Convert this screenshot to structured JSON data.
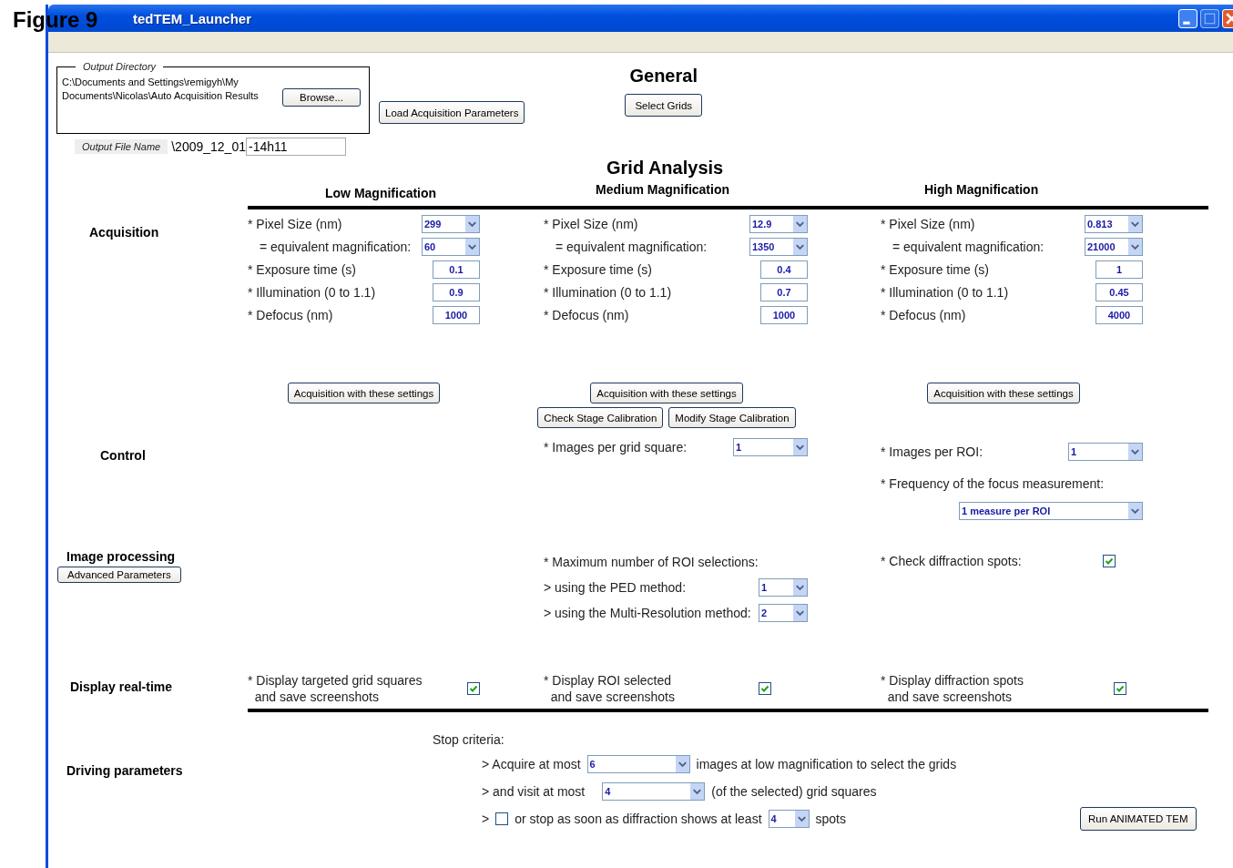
{
  "figure_label": "Figure 9",
  "window": {
    "title": "tedTEM_Launcher"
  },
  "output_directory": {
    "legend": "Output Directory",
    "path": "C:\\Documents and Settings\\remigyh\\My Documents\\Nicolas\\Auto Acquisition Results",
    "browse_button": "Browse..."
  },
  "load_button": "Load Acquisition Parameters",
  "general": {
    "heading": "General",
    "button": "Select Grids"
  },
  "output_file_name": {
    "label": "Output File Name",
    "prefix": "\\2009_12_01",
    "value": "-14h11"
  },
  "grid_analysis": {
    "heading": "Grid Analysis",
    "columns": [
      "Low Magnification",
      "Medium Magnification",
      "High Magnification"
    ]
  },
  "sections": [
    {
      "label": "Acquisition",
      "columns": [
        {
          "items": [
            {
              "kind": "select",
              "label": "* Pixel Size (nm)",
              "value": "299"
            },
            {
              "kind": "derived_select",
              "label": "= equivalent magnification:",
              "value": "60"
            },
            {
              "kind": "input",
              "label": "* Exposure time (s)",
              "value": "0.1"
            },
            {
              "kind": "input",
              "label": "* Illumination (0 to 1.1)",
              "value": "0.9"
            },
            {
              "kind": "input",
              "label": "* Defocus (nm)",
              "value": "1000"
            }
          ],
          "buttons": [
            "Acquisition with these settings"
          ]
        },
        {
          "items": [
            {
              "kind": "select",
              "label": "* Pixel Size (nm)",
              "value": "12.9"
            },
            {
              "kind": "derived_select",
              "label": "= equivalent magnification:",
              "value": "1350"
            },
            {
              "kind": "input",
              "label": "* Exposure time (s)",
              "value": "0.4"
            },
            {
              "kind": "input",
              "label": "* Illumination (0 to 1.1)",
              "value": "0.7"
            },
            {
              "kind": "input",
              "label": "* Defocus (nm)",
              "value": "1000"
            }
          ],
          "buttons": [
            "Acquisition with these settings"
          ],
          "extra_buttons": [
            "Check Stage Calibration",
            "Modify Stage Calibration"
          ]
        },
        {
          "items": [
            {
              "kind": "select",
              "label": "* Pixel Size (nm)",
              "value": "0.813"
            },
            {
              "kind": "derived_select",
              "label": "= equivalent magnification:",
              "value": "21000"
            },
            {
              "kind": "input",
              "label": "* Exposure time (s)",
              "value": "1"
            },
            {
              "kind": "input",
              "label": "* Illumination (0 to 1.1)",
              "value": "0.45"
            },
            {
              "kind": "input",
              "label": "* Defocus (nm)",
              "value": "4000"
            }
          ],
          "buttons": [
            "Acquisition with these settings"
          ]
        }
      ]
    },
    {
      "label": "Control",
      "columns": [
        {},
        {
          "items": [
            {
              "kind": "long_select",
              "label": "* Images per grid square:",
              "value": "1"
            }
          ]
        },
        {
          "items": [
            {
              "kind": "long_select",
              "label": "* Images per ROI:",
              "value": "1"
            },
            {
              "kind": "text",
              "label": "* Frequency of the focus measurement:"
            },
            {
              "kind": "wide_select",
              "value": "1 measure per ROI"
            }
          ]
        }
      ]
    },
    {
      "label": "Image processing",
      "button": "Advanced Parameters",
      "columns": [
        {},
        {
          "items": [
            {
              "kind": "text",
              "label": "* Maximum number of ROI selections:"
            },
            {
              "kind": "small_select",
              "label": "> using the PED method:",
              "value": "1"
            },
            {
              "kind": "small_select",
              "label": "> using the Multi-Resolution method:",
              "value": "2"
            }
          ]
        },
        {
          "items": [
            {
              "kind": "checkbox",
              "label": "* Check diffraction spots:",
              "checked": true
            }
          ]
        }
      ]
    },
    {
      "label": "Display real-time",
      "columns": [
        {
          "items": [
            {
              "kind": "checkbox",
              "label": "* Display targeted grid squares\n  and save screenshots",
              "checked": true
            }
          ]
        },
        {
          "items": [
            {
              "kind": "checkbox",
              "label": "* Display ROI selected\n  and save screenshots",
              "checked": true
            }
          ]
        },
        {
          "items": [
            {
              "kind": "checkbox",
              "label": "* Display diffraction spots\n  and save screenshots",
              "checked": true
            }
          ]
        }
      ]
    }
  ],
  "driving": {
    "label": "Driving parameters",
    "stop_label": "Stop criteria:",
    "acquire": {
      "before": "> Acquire at most",
      "value": "6",
      "after": "images at low magnification to select the grids"
    },
    "visit": {
      "before": "> and visit at most",
      "value": "4",
      "after": "(of the selected) grid squares"
    },
    "stop": {
      "before": ">",
      "checked": false,
      "middle": "or stop as soon as diffraction shows at least",
      "value": "4",
      "after": "spots"
    },
    "run_button": "Run ANIMATED TEM"
  }
}
